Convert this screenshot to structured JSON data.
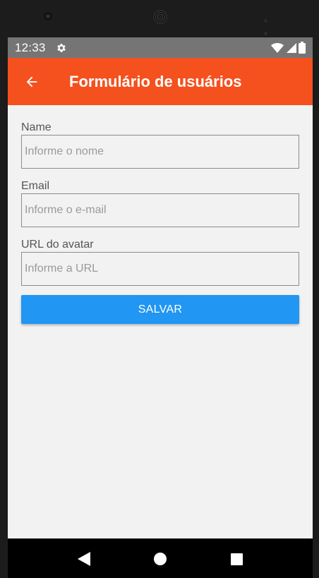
{
  "status_bar": {
    "time": "12:33",
    "icons": [
      "settings-gear-icon",
      "wifi-icon",
      "cell-signal-icon",
      "battery-icon"
    ]
  },
  "app_bar": {
    "title": "Formulário de usuários",
    "back_icon": "arrow-left-icon",
    "color": "#f4511e"
  },
  "form": {
    "fields": [
      {
        "label": "Name",
        "placeholder": "Informe o nome",
        "value": ""
      },
      {
        "label": "Email",
        "placeholder": "Informe o e-mail",
        "value": ""
      },
      {
        "label": "URL do avatar",
        "placeholder": "Informe a URL",
        "value": ""
      }
    ],
    "submit_label": "SALVAR",
    "submit_color": "#2196f3"
  },
  "nav_bar": {
    "icons": [
      "nav-back-icon",
      "nav-home-icon",
      "nav-recents-icon"
    ]
  }
}
